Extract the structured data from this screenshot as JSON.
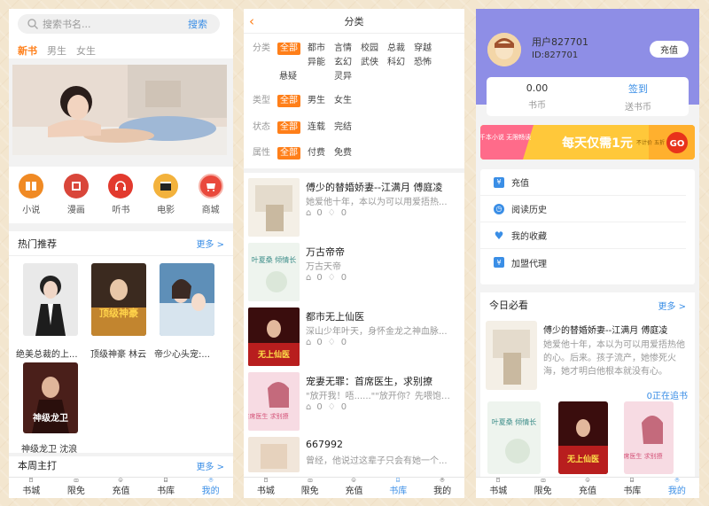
{
  "colors": {
    "accent": "#ff7f19",
    "link": "#3a8ee6",
    "header_purple": "#8e8ee6"
  },
  "tabbar": [
    {
      "label": "书城",
      "icon": "book-icon"
    },
    {
      "label": "限免",
      "icon": "gift-icon"
    },
    {
      "label": "充值",
      "icon": "coin-icon"
    },
    {
      "label": "书库",
      "icon": "bookshelf-icon"
    },
    {
      "label": "我的",
      "icon": "user-icon"
    }
  ],
  "home": {
    "search_placeholder": "搜索书名...",
    "search_button": "搜索",
    "gender_tabs": [
      "新书",
      "男生",
      "女生"
    ],
    "categories": [
      {
        "label": "小说",
        "icon": "novel-icon"
      },
      {
        "label": "漫画",
        "icon": "comic-icon"
      },
      {
        "label": "听书",
        "icon": "audiobook-icon"
      },
      {
        "label": "电影",
        "icon": "movie-icon"
      },
      {
        "label": "商城",
        "icon": "shop-icon"
      }
    ],
    "hot": {
      "title": "热门推荐",
      "more": "更多 >",
      "books": [
        {
          "title": "绝美总裁的上..."
        },
        {
          "title": "顶级神豪 林云",
          "cover_text": "顶级神豪"
        },
        {
          "title": "帝少心头宠:..."
        },
        {
          "title": "神级龙卫 沈浪",
          "cover_text": "神级龙卫"
        }
      ]
    },
    "next_section": {
      "title": "本周主打",
      "more": "更多 >"
    }
  },
  "category_page": {
    "title": "分类",
    "filters": [
      {
        "label": "分类",
        "options": [
          "全部",
          "都市",
          "言情",
          "校园",
          "总裁",
          "穿越",
          "异能",
          "玄幻",
          "武侠",
          "科幻",
          "恐怖",
          "悬疑",
          "灵异"
        ]
      },
      {
        "label": "类型",
        "options": [
          "全部",
          "男生",
          "女生"
        ]
      },
      {
        "label": "状态",
        "options": [
          "全部",
          "连载",
          "完结"
        ]
      },
      {
        "label": "属性",
        "options": [
          "全部",
          "付费",
          "免费"
        ]
      }
    ],
    "books": [
      {
        "title": "傅少的替婚娇妻--江满月 傅庭凌",
        "desc": "她爱他十年，本以为可以用爱捂热...",
        "views": "0",
        "likes": "0"
      },
      {
        "title": "万古帝帝",
        "desc": "万古天帝",
        "views": "0",
        "likes": "0",
        "cover_text": "叶夏桑 倾情长"
      },
      {
        "title": "都市无上仙医",
        "desc": "深山少年叶天，身怀金龙之神血脉...",
        "views": "0",
        "likes": "0",
        "cover_text": "无上仙医"
      },
      {
        "title": "宠妻无罪：首席医生，求别撩",
        "desc": "\"放开我！唔......\"\"放开你？先喂饱我...",
        "views": "0",
        "likes": "0",
        "cover_text": "首席医生 求别撩"
      },
      {
        "title": "667992",
        "desc": "曾经，他说过这辈子只会有她一个...",
        "views": "0",
        "likes": "0"
      }
    ]
  },
  "profile": {
    "username": "用户827701",
    "user_id": "ID:827701",
    "recharge_button": "充值",
    "coins_value": "0.00",
    "coins_label": "书币",
    "signin_label": "签到",
    "gift_coins_label": "送书币",
    "promo": {
      "left": "千本小说 无限畅读",
      "main": "每天仅需1元",
      "side": "不计价 五折",
      "go": "GO"
    },
    "menu": [
      {
        "label": "充值",
        "icon": "yen-icon"
      },
      {
        "label": "阅读历史",
        "icon": "clock-icon"
      },
      {
        "label": "我的收藏",
        "icon": "heart-icon"
      },
      {
        "label": "加盟代理",
        "icon": "yen-icon"
      }
    ],
    "today": {
      "title": "今日必看",
      "more": "更多 >",
      "book_title": "傅少的替婚娇妻--江满月 傅庭凌",
      "book_desc": "她爱他十年，本以为可以用爱捂热他的心。后来。孩子流产，她惨死火海，她才明白他根本就没有心。",
      "reading": "0正在追书"
    }
  }
}
